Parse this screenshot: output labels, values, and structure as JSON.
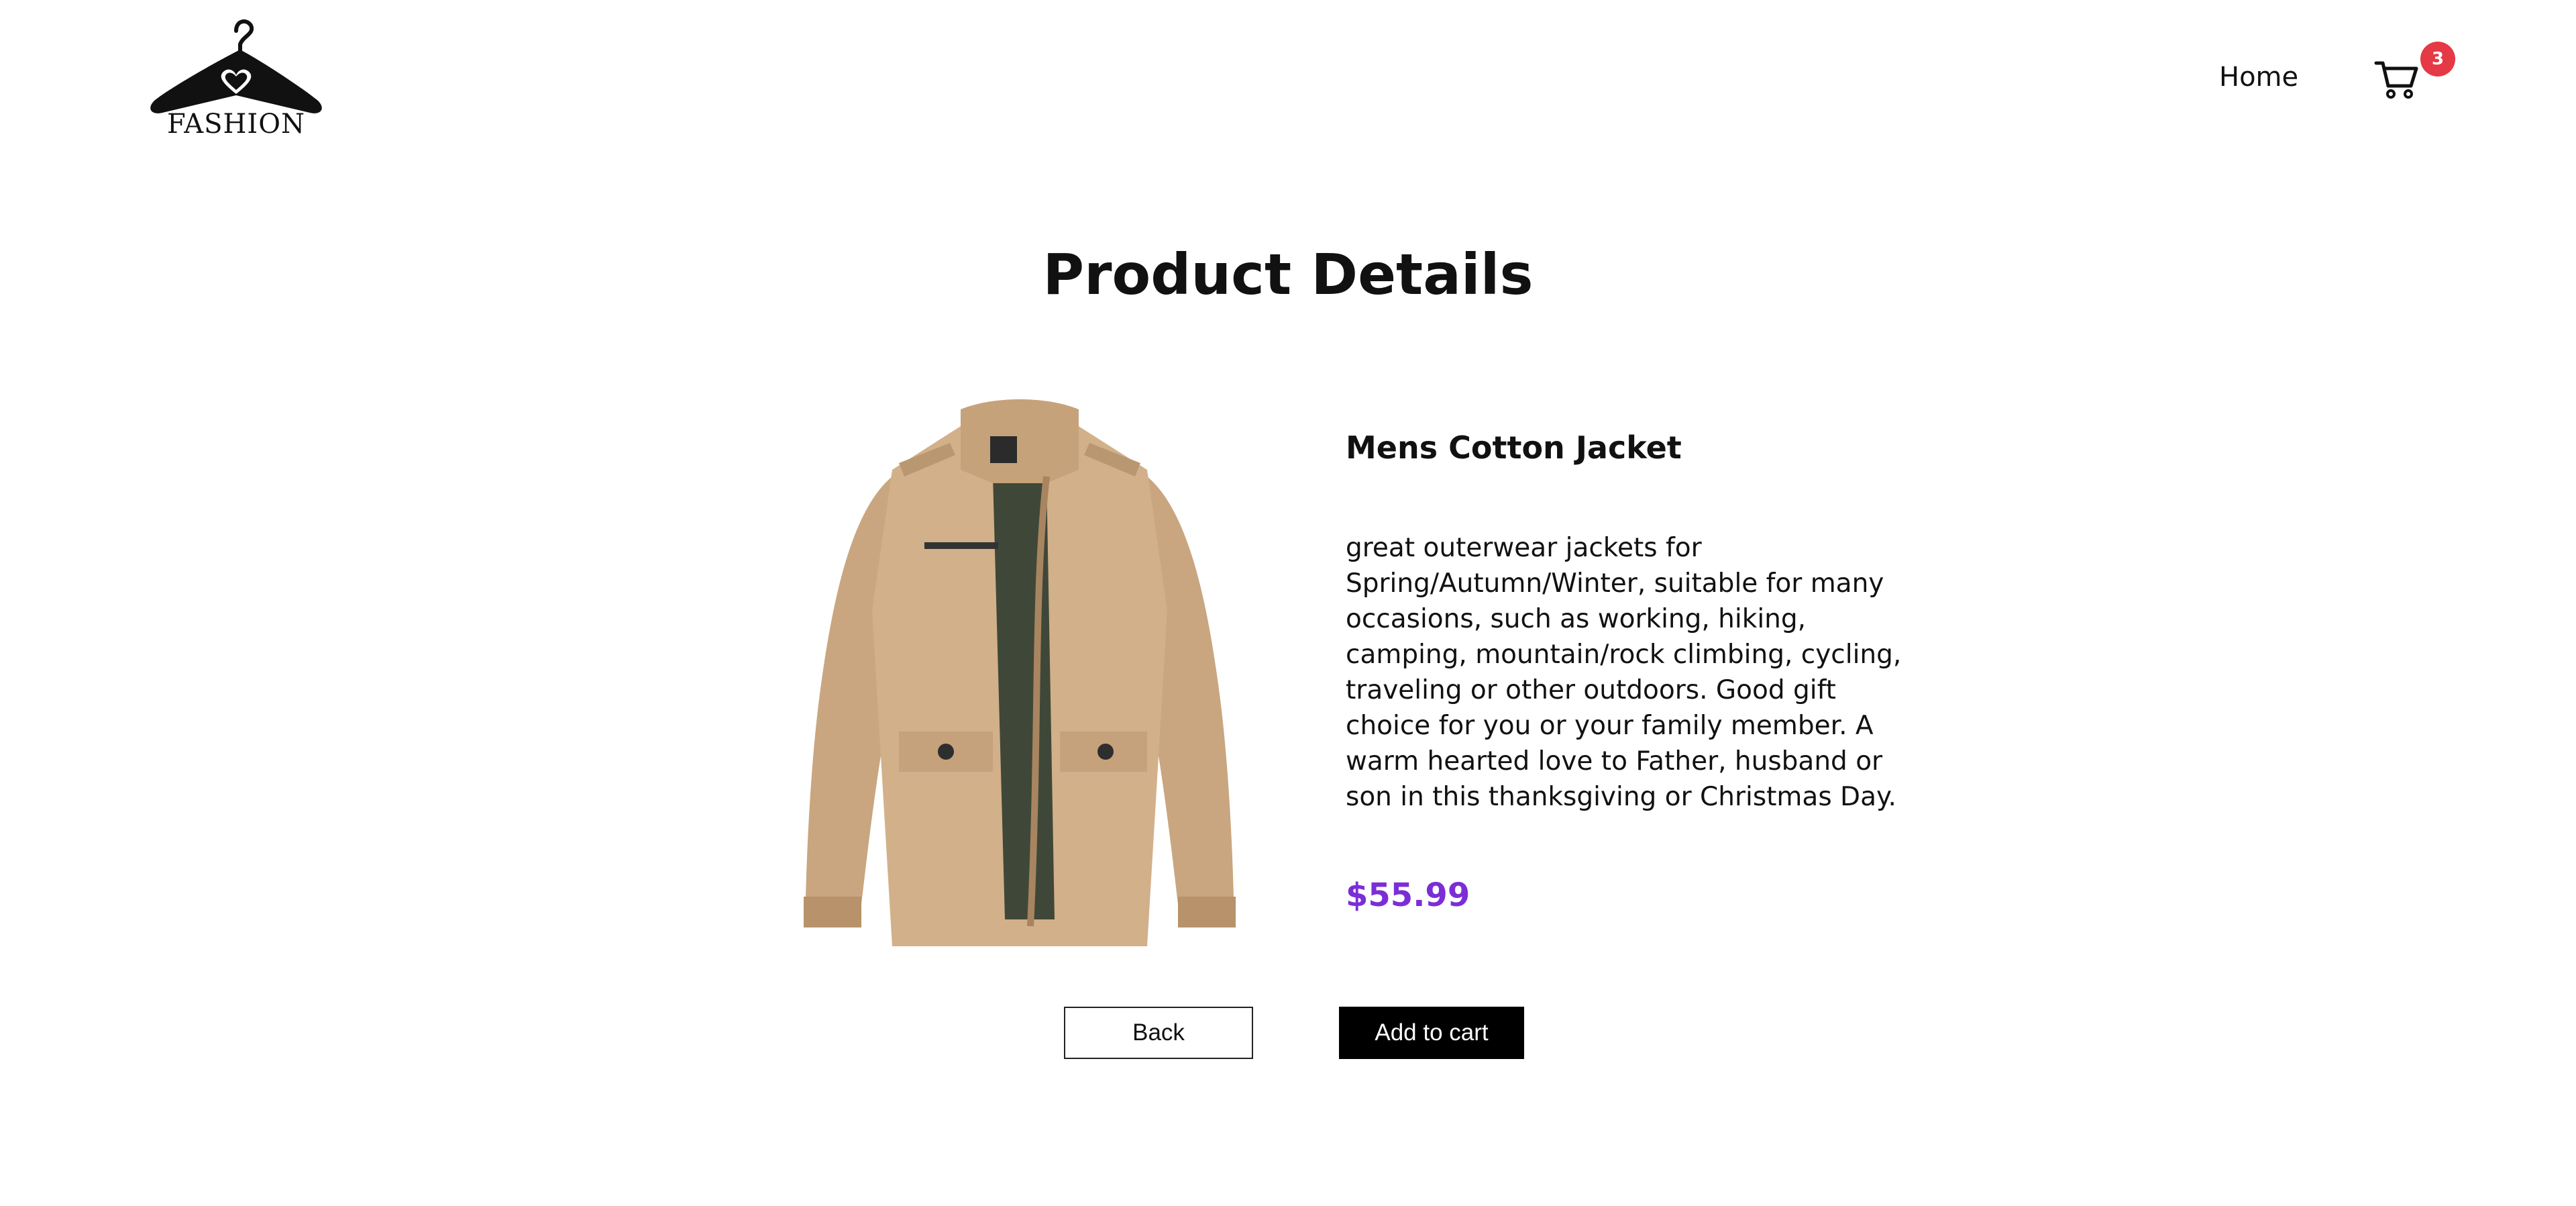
{
  "header": {
    "logo_text": "FASHION",
    "nav": {
      "home_label": "Home"
    },
    "cart": {
      "icon": "cart-icon",
      "count": "3",
      "badge_color": "#e53945"
    }
  },
  "main": {
    "title": "Product Details",
    "product": {
      "image_icon": "jacket-image",
      "name": "Mens Cotton Jacket",
      "description": "great outerwear jackets for Spring/Autumn/Winter, suitable for many occasions, such as working, hiking, camping, mountain/rock climbing, cycling, traveling or other outdoors. Good gift choice for you or your family member. A warm hearted love to Father, husband or son in this thanksgiving or Christmas Day.",
      "price": "$55.99",
      "price_color": "#7b2ed6"
    },
    "actions": {
      "back_label": "Back",
      "add_to_cart_label": "Add to cart"
    }
  }
}
